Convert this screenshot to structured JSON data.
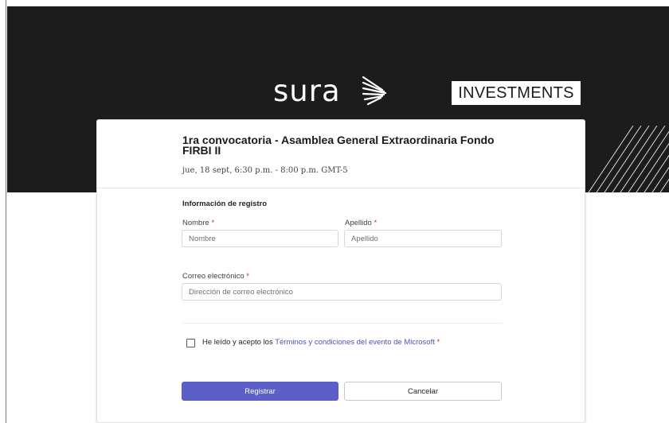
{
  "banner": {
    "brand_name": "sura",
    "brand_suffix": "INVESTMENTS",
    "background_color": "#1c1c1c"
  },
  "event": {
    "title": "1ra convocatoria - Asamblea General Extraordinaria Fondo FIRBI II",
    "datetime": "jue, 18 sept, 6:30 p.m. - 8:00 p.m. GMT-5"
  },
  "form": {
    "section_title": "Información de registro",
    "first_name": {
      "label": "Nombre",
      "required_mark": "*",
      "placeholder": "Nombre",
      "value": ""
    },
    "last_name": {
      "label": "Apellido",
      "required_mark": "*",
      "placeholder": "Apellido",
      "value": ""
    },
    "email": {
      "label": "Correo electrónico",
      "required_mark": "*",
      "placeholder": "Dirección de correo electrónico",
      "value": ""
    },
    "terms": {
      "prefix": "He leído y acepto los",
      "link_text": "Términos y condiciones del evento de Microsoft",
      "required_mark": "*",
      "checked": false
    },
    "submit_label": "Registrar",
    "cancel_label": "Cancelar"
  },
  "colors": {
    "primary_button": "#5b5fc7",
    "link": "#4f52b2",
    "required": "#c4314b"
  },
  "icons": {
    "brand_mark": "sura-wing-icon"
  }
}
